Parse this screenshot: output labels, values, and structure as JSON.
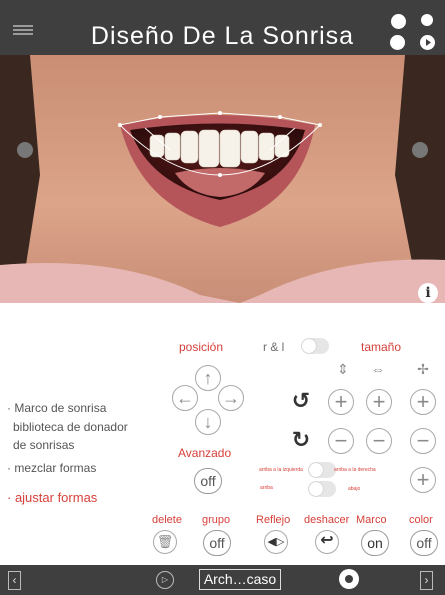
{
  "header": {
    "title": "Diseño De La Sonrisa"
  },
  "panel": {
    "posicion_label": "posición",
    "r_and_l_label": "r & l",
    "tamano_label": "tamaño",
    "avanzado_label": "Avanzado",
    "avanzado_toggle": "off",
    "left_up_label": "arriba a la izquierda",
    "right_up_label": "arriba a la derecha",
    "up_label": "arriba",
    "down_label": "abajo",
    "menu": [
      "· Marco de sonrisa",
      "biblioteca de donador",
      "de sonrisas",
      "· mezclar formas",
      "· ajustar formas"
    ],
    "actions": {
      "delete": "delete",
      "grupo": "grupo",
      "grupo_state": "off",
      "reflejo": "Reflejo",
      "deshacer": "deshacer",
      "marco": "Marco",
      "marco_state": "on",
      "color": "color",
      "color_state": "off"
    }
  },
  "footer": {
    "file_name": "Arch…caso"
  },
  "colors": {
    "bar": "#3f3f3f",
    "accent": "#d7403a"
  }
}
